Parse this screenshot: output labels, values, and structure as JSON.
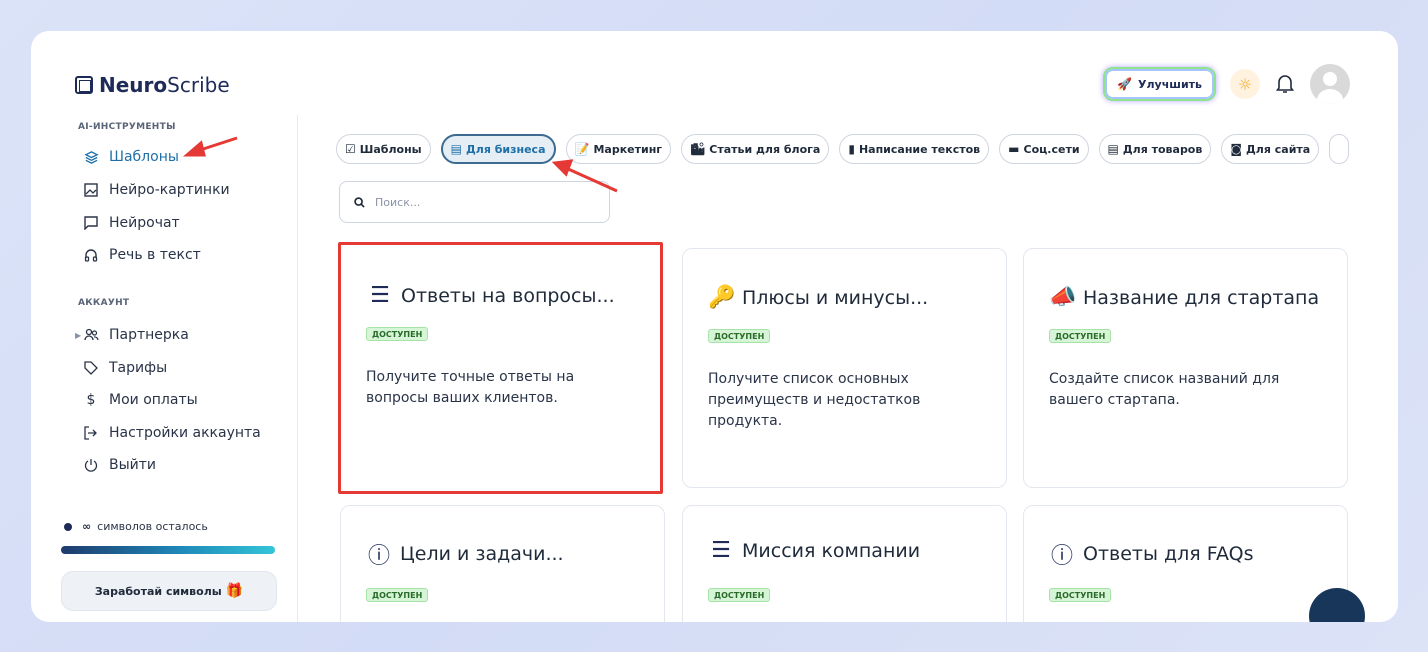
{
  "header": {
    "logo_bold": "Neuro",
    "logo_rest": "Scribe",
    "upgrade_label": "Улучшить"
  },
  "sidebar": {
    "ai_section": "AI-ИНСТРУМЕНТЫ",
    "ai_items": [
      {
        "label": "Шаблоны",
        "icon": "layers-icon",
        "active": true
      },
      {
        "label": "Нейро-картинки",
        "icon": "image-icon"
      },
      {
        "label": "Нейрочат",
        "icon": "chat-icon"
      },
      {
        "label": "Речь в текст",
        "icon": "headphones-icon"
      }
    ],
    "account_section": "АККАУНТ",
    "account_items": [
      {
        "label": "Партнерка",
        "icon": "users-icon"
      },
      {
        "label": "Тарифы",
        "icon": "tag-icon"
      },
      {
        "label": "Мои оплаты",
        "icon": "dollar-icon"
      },
      {
        "label": "Настройки аккаунта",
        "icon": "login-icon"
      },
      {
        "label": "Выйти",
        "icon": "power-icon"
      }
    ],
    "credits_symbol": "∞",
    "credits_text": "символов осталось",
    "earn_label": "Заработай символы"
  },
  "filters": [
    {
      "label": "Шаблоны",
      "icon": "☑"
    },
    {
      "label": "Для бизнеса",
      "icon": "▤",
      "active": true
    },
    {
      "label": "Маркетинг",
      "icon": "📝"
    },
    {
      "label": "Статьи для блога",
      "icon": "🏙"
    },
    {
      "label": "Написание текстов",
      "icon": "▮"
    },
    {
      "label": "Соц.сети",
      "icon": "▬"
    },
    {
      "label": "Для товаров",
      "icon": "▤"
    },
    {
      "label": "Для сайта",
      "icon": "◙"
    }
  ],
  "search": {
    "placeholder": "Поиск..."
  },
  "cards": [
    {
      "title": "Ответы на вопросы...",
      "badge": "ДОСТУПЕН",
      "desc": "Получите точные ответы на вопросы ваших клиентов.",
      "icon": "☰"
    },
    {
      "title": "Плюсы и минусы...",
      "badge": "ДОСТУПЕН",
      "desc": "Получите список основных преимуществ и недостатков продукта.",
      "icon": "🔑"
    },
    {
      "title": "Название для стартапа",
      "badge": "ДОСТУПЕН",
      "desc": "Создайте список названий для вашего стартапа.",
      "icon": "📣"
    },
    {
      "title": "Цели и задачи...",
      "badge": "ДОСТУПЕН",
      "desc": "",
      "icon": "ⓘ"
    },
    {
      "title": "Миссия компании",
      "badge": "ДОСТУПЕН",
      "desc": "",
      "icon": "☰"
    },
    {
      "title": "Ответы для FAQs",
      "badge": "ДОСТУПЕН",
      "desc": "",
      "icon": "ⓘ"
    }
  ],
  "colors": {
    "accent": "#1e6fa8",
    "highlight": "#e53935",
    "badge_bg": "#d6f5d6"
  }
}
